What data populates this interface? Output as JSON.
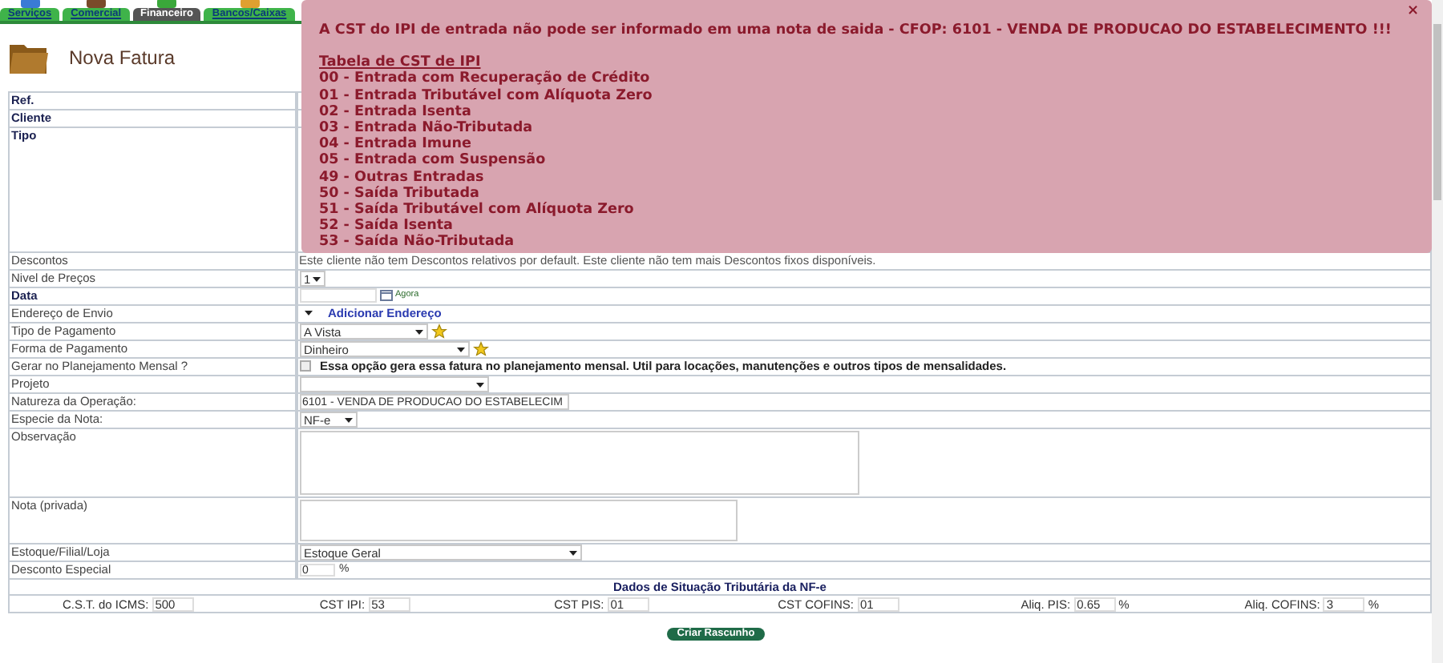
{
  "nav": {
    "tabs": [
      {
        "label": "Serviços",
        "selected": false
      },
      {
        "label": "Comercial",
        "selected": false
      },
      {
        "label": "Financeiro",
        "selected": true
      },
      {
        "label": "Bancos/Caixas",
        "selected": false
      }
    ]
  },
  "page": {
    "title": "Nova Fatura"
  },
  "form": {
    "rows": [
      {
        "label": "Ref.",
        "required": true,
        "kind": "blank"
      },
      {
        "label": "Cliente",
        "required": true,
        "kind": "blank"
      },
      {
        "label": "Tipo",
        "required": true,
        "kind": "tall"
      },
      {
        "label": "Descontos",
        "required": false,
        "kind": "text",
        "text": "Este cliente não tem Descontos relativos por default. Este cliente não tem mais Descontos fixos disponíveis."
      },
      {
        "label": "Nivel de Preços",
        "required": false,
        "kind": "select",
        "value": "1",
        "starred": false
      },
      {
        "label": "Data",
        "required": true,
        "kind": "date",
        "link": "Agora"
      },
      {
        "label": "Endereço de Envio",
        "required": false,
        "kind": "address",
        "link": "Adicionar Endereço"
      },
      {
        "label": "Tipo de Pagamento",
        "required": false,
        "kind": "select",
        "value": "A Vista",
        "starred": true
      },
      {
        "label": "Forma de Pagamento",
        "required": false,
        "kind": "select",
        "value": "Dinheiro",
        "starred": true
      },
      {
        "label": "Gerar no Planejamento Mensal ?",
        "required": false,
        "kind": "checkbox",
        "checked": false,
        "text": "Essa opção gera essa fatura no planejamento mensal. Util para locações, manutenções e outros tipos de mensalidades."
      },
      {
        "label": "Projeto",
        "required": false,
        "kind": "select",
        "starred": false
      },
      {
        "label": "Natureza da Operação:",
        "required": false,
        "kind": "input",
        "value": "6101 - VENDA DE PRODUCAO DO ESTABELECIM"
      },
      {
        "label": "Especie da Nota:",
        "required": false,
        "kind": "select",
        "value": "NF-e",
        "starred": false
      },
      {
        "label": "Observação",
        "required": false,
        "kind": "textarea"
      },
      {
        "label": "Nota (privada)",
        "required": false,
        "kind": "textarea"
      },
      {
        "label": "Estoque/Filial/Loja",
        "required": false,
        "kind": "select",
        "value": "Estoque Geral",
        "starred": false
      },
      {
        "label": "Desconto Especial",
        "required": false,
        "kind": "percent",
        "value": "0",
        "suffix": "%"
      }
    ]
  },
  "tax": {
    "heading": "Dados de Situação Tributária da NF-e",
    "fields": [
      {
        "label": "C.S.T. do ICMS:",
        "value": "500"
      },
      {
        "label": "CST IPI:",
        "value": "53"
      },
      {
        "label": "CST PIS:",
        "value": "01"
      },
      {
        "label": "CST COFINS:",
        "value": "01"
      },
      {
        "label": "Aliq. PIS:",
        "value": "0.65",
        "suffix": "%"
      },
      {
        "label": "Aliq. COFINS:",
        "value": "3",
        "suffix": "%"
      }
    ]
  },
  "button": "Criar Rascunho",
  "alert": {
    "close": "×",
    "title": "A CST do IPI de entrada não pode ser informado em uma nota de saida - CFOP: 6101 - VENDA DE PRODUCAO DO ESTABELECIMENTO !!!",
    "table_heading": "Tabela de CST de IPI",
    "lines": [
      "00 - Entrada com Recuperação de Crédito",
      "01 - Entrada Tributável com Alíquota Zero",
      "02 - Entrada Isenta",
      "03 - Entrada Não-Tributada",
      "04 - Entrada Imune",
      "05 - Entrada com Suspensão",
      "49 - Outras Entradas",
      "50 - Saída Tributada",
      "51 - Saída Tributável com Alíquota Zero",
      "52 - Saída Isenta",
      "53 - Saída Não-Tributada"
    ]
  }
}
